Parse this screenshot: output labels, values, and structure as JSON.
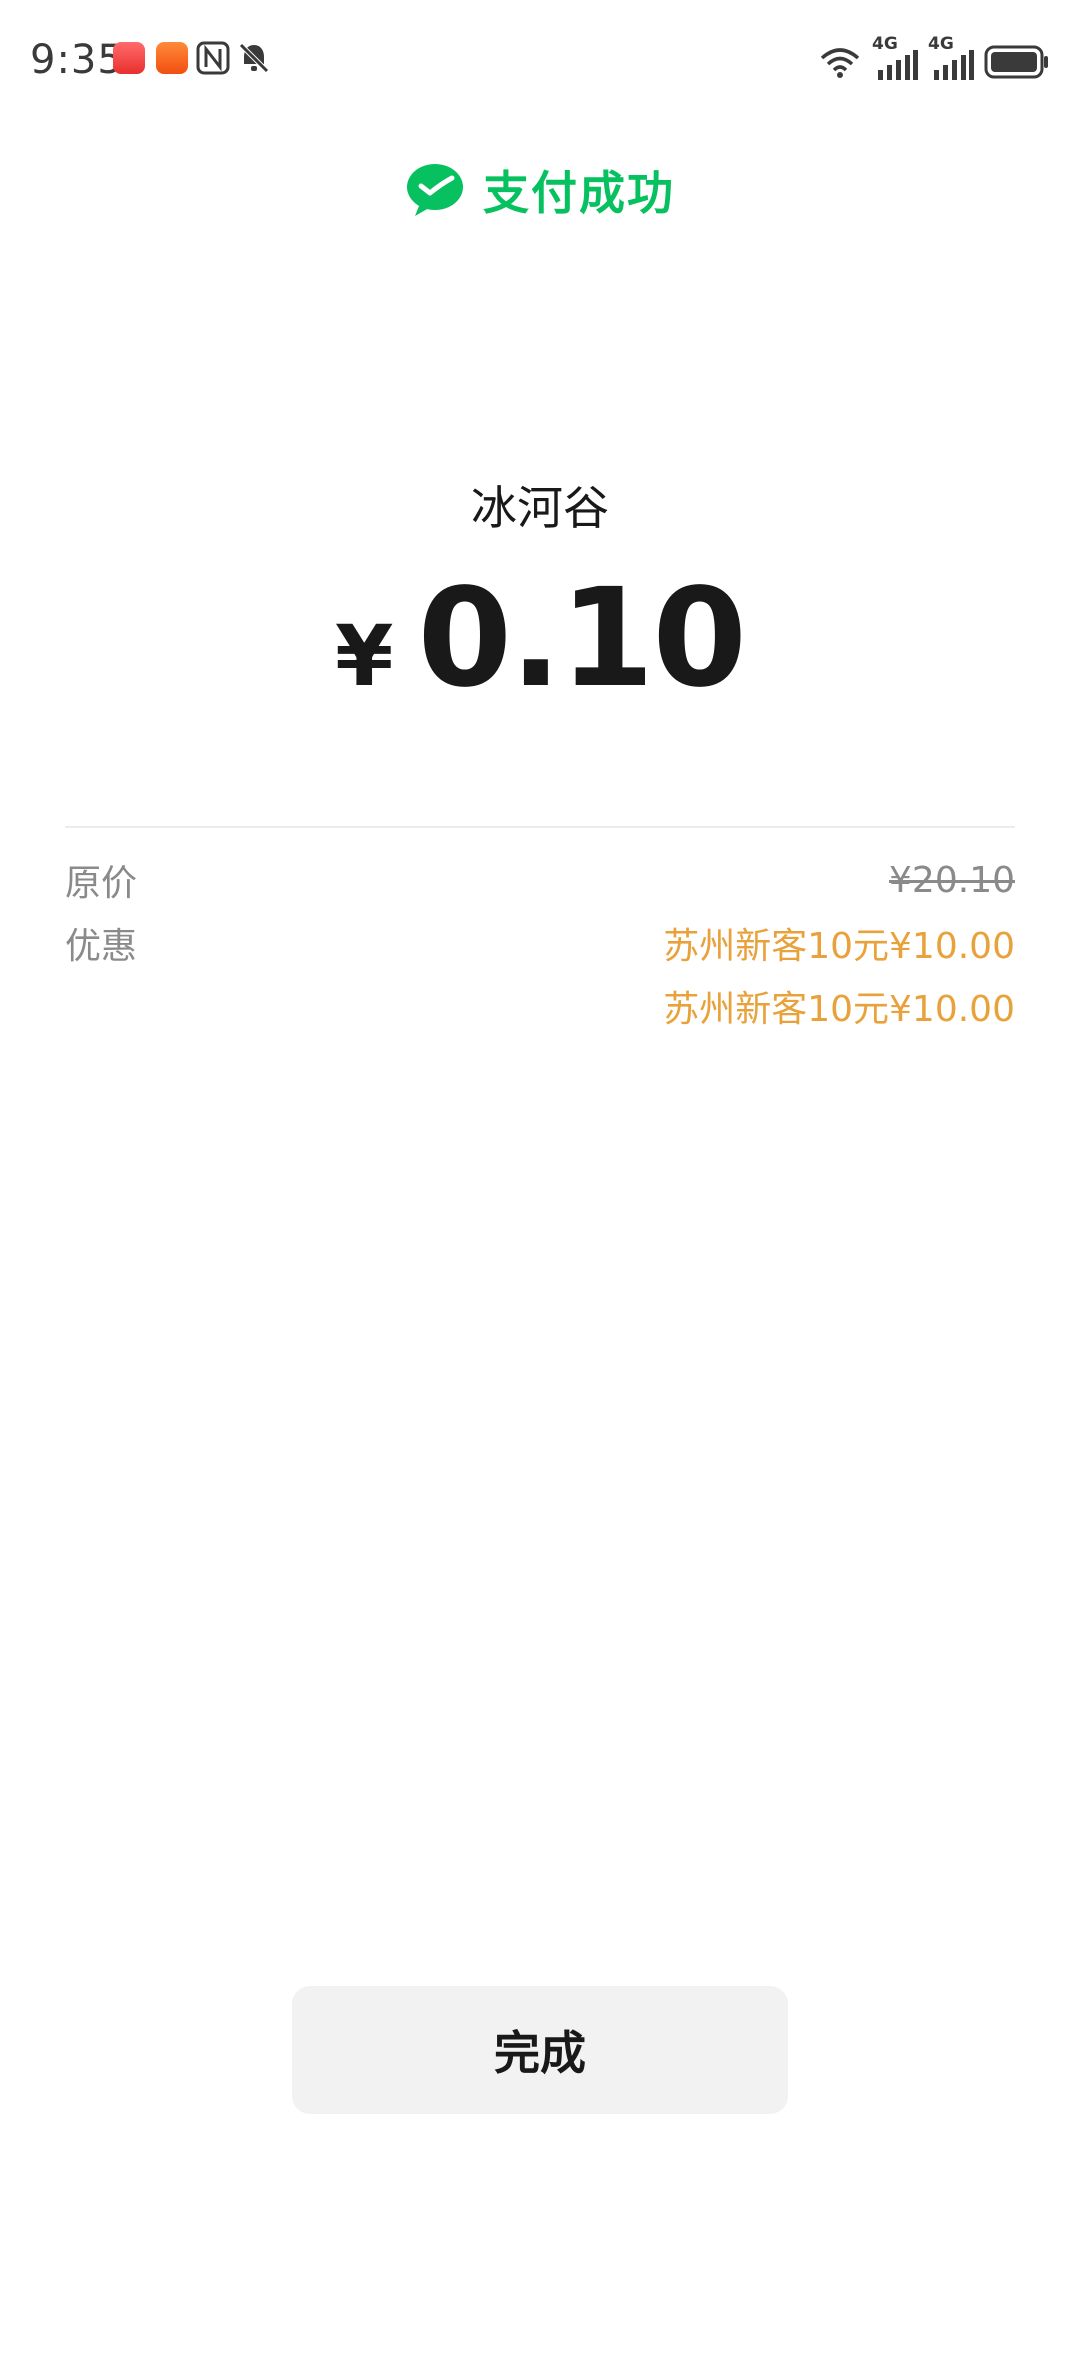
{
  "status_bar": {
    "time": "9:35",
    "network_1": "4G",
    "network_2": "4G",
    "icons": [
      "app-red-icon",
      "app-orange-icon",
      "nfc-icon",
      "mute-bell-icon",
      "wifi-icon",
      "signal-icon",
      "signal-icon",
      "battery-icon"
    ]
  },
  "header": {
    "title": "支付成功",
    "icon": "wechat-pay-check-icon",
    "accent_color": "#07c160"
  },
  "payment": {
    "merchant": "冰河谷",
    "currency_symbol": "¥",
    "amount": "0.10"
  },
  "details": {
    "original_label": "原价",
    "original_value": "¥20.10",
    "discount_label": "优惠",
    "discounts": [
      "苏州新客10元¥10.00",
      "苏州新客10元¥10.00"
    ],
    "discount_color": "#e9a23b"
  },
  "actions": {
    "done_label": "完成"
  }
}
